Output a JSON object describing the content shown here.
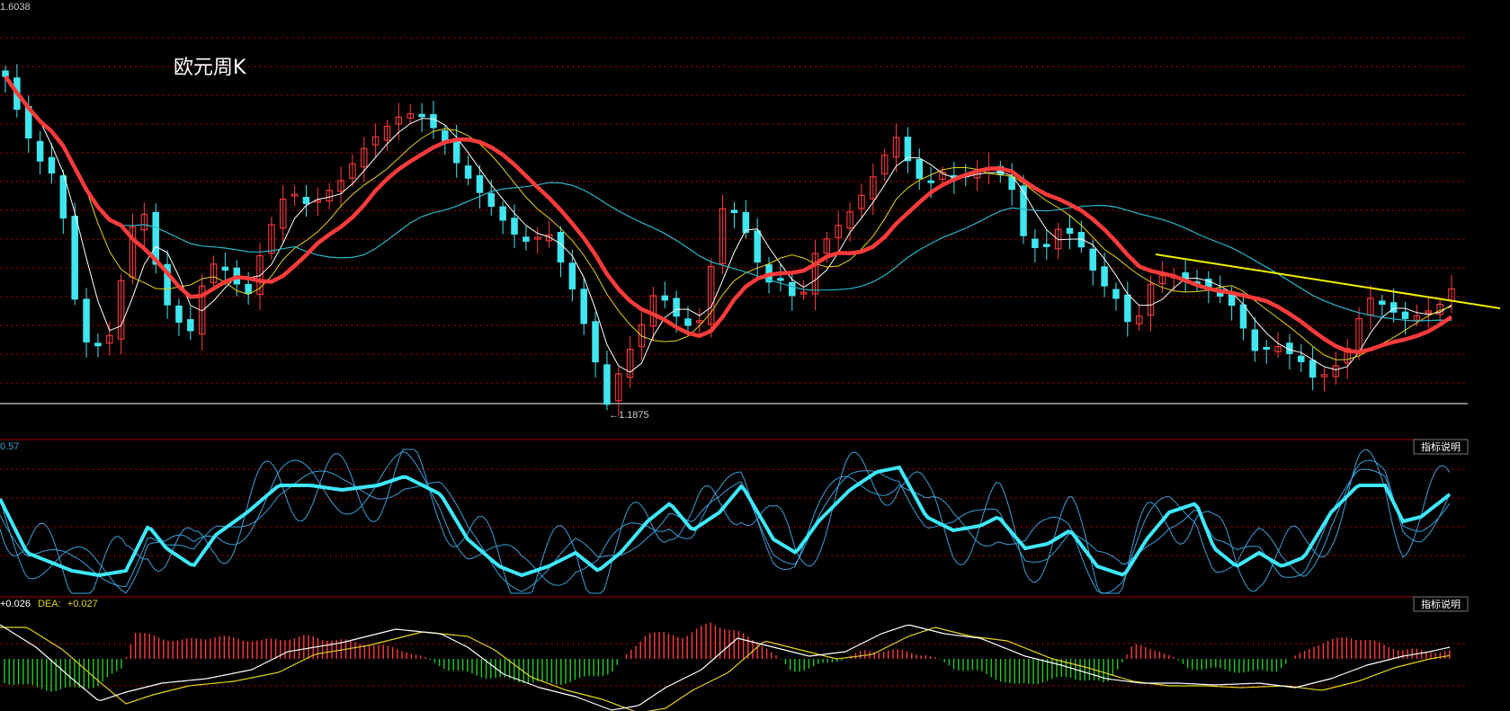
{
  "chart_data": {
    "type": "candlestick",
    "title": "欧元周K",
    "main_panel": {
      "top_value_label": "1.6038",
      "low_marker_label": "←1.1875",
      "bars": 126,
      "colors": {
        "up": "#ff3b3b",
        "down": "#3fe6f0",
        "ma_thick": "#ff3b3b",
        "ma_cyan": "#2ab8cc",
        "ma_yellow": "#e6d21a",
        "ma_white": "#ffffff",
        "trendline": "#f0f000",
        "grid": "#8b0000",
        "support": "#cccccc"
      }
    },
    "kdj_panel": {
      "value_label": "0.57",
      "button_label": "指标说明",
      "colors": {
        "thick": "#3ee8ff",
        "thin": "#3a9fd8"
      }
    },
    "macd_panel": {
      "diff_label": "+0.026",
      "dea_prefix": "DEA:",
      "dea_label": "+0.027",
      "button_label": "指标说明",
      "colors": {
        "pos_bar": "#ff3b3b",
        "neg_bar": "#22cc22",
        "diff": "#ffffff",
        "dea": "#e6d21a"
      }
    }
  }
}
